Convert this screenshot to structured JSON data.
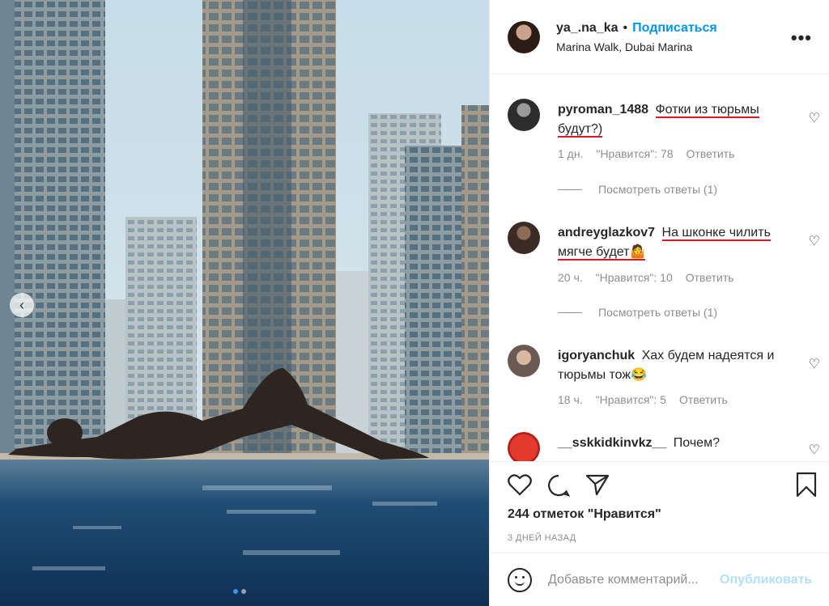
{
  "post": {
    "username": "ya_.na_ka",
    "separator": "•",
    "follow_label": "Подписаться",
    "location": "Marina Walk, Dubai Marina",
    "more_icon": "more-horizontal-icon"
  },
  "comments": [
    {
      "username": "pyroman_1488",
      "text": "Фотки из тюрьмы будут?)",
      "time": "1 дн.",
      "likes": "\"Нравится\": 78",
      "reply": "Ответить",
      "view_replies": "Посмотреть ответы (1)"
    },
    {
      "username": "andreyglazkov7",
      "text": "На шконке чилить мягче будет🤷",
      "time": "20 ч.",
      "likes": "\"Нравится\": 10",
      "reply": "Ответить",
      "view_replies": "Посмотреть ответы (1)"
    },
    {
      "username": "igoryanchuk",
      "text": "Хах будем надеятся и тюрьмы тож😂",
      "time": "18 ч.",
      "likes": "\"Нравится\": 5",
      "reply": "Ответить"
    },
    {
      "username": "__sskkidkinvkz__",
      "text": "Почем?"
    }
  ],
  "actions": {
    "likes_count": "244 отметок \"Нравится\"",
    "time_ago": "3 ДНЕЙ НАЗАД"
  },
  "add_comment": {
    "placeholder": "Добавьте комментарий...",
    "publish_label": "Опубликовать"
  },
  "colors": {
    "accent": "#0095f6",
    "underline": "#d81b24",
    "muted": "#8e8e8e"
  }
}
